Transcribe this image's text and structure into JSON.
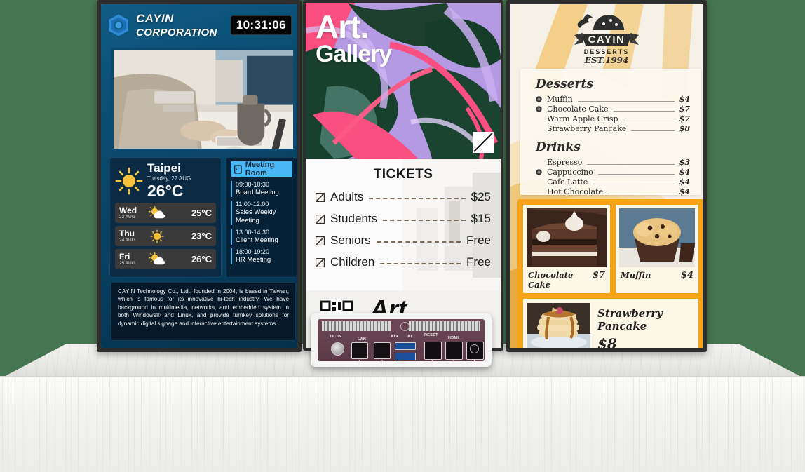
{
  "background_color": "#467552",
  "pedestal": {
    "name": "marble-display-pedestal"
  },
  "left_screen": {
    "name": "corporate-signage-screen",
    "header": {
      "logo_name": "cayin-hexagon-logo",
      "title_line1": "CAYIN",
      "title_line2": "CORPORATION",
      "clock": "10:31:06"
    },
    "photo_caption": "office-worker-photo",
    "weather": {
      "icon": "sun-icon",
      "city": "Taipei",
      "date": "Tuesday, 22 AUG",
      "temperature": "26°C",
      "forecast": [
        {
          "day": "Wed",
          "date": "23 AUG",
          "icon": "sun-cloud-icon",
          "temp": "25°C"
        },
        {
          "day": "Thu",
          "date": "24 AUG",
          "icon": "sun-icon",
          "temp": "23°C"
        },
        {
          "day": "Fri",
          "date": "25 AUG",
          "icon": "sun-cloud-icon",
          "temp": "26°C"
        }
      ]
    },
    "meeting_room": {
      "icon": "door-icon",
      "title": "Meeting Room",
      "entries": [
        {
          "time": "09:00-10:30",
          "name": "Board Meeting"
        },
        {
          "time": "11:00-12:00",
          "name": "Sales Weekly Meeting"
        },
        {
          "time": "13:00-14:30",
          "name": "Client Meeting"
        },
        {
          "time": "18:00-19:20",
          "name": "HR Meeting"
        }
      ]
    },
    "description": "CAYIN Technology Co., Ltd., founded in 2004, is based in Taiwan, which is famous for its innovative hi-tech industry. We have background in multimedia, networks, and embedded system in both Windows® and Linux, and provide turnkey solutions for dynamic digital signage and interactive entertainment systems."
  },
  "middle_screen": {
    "name": "art-gallery-signage-screen",
    "gallery": {
      "title_line1": "Art.",
      "title_line2": "Gallery",
      "logo_name": "gallery-mark-icon"
    },
    "tickets": {
      "title": "TICKETS",
      "rows": [
        {
          "icon": "ticket-icon",
          "label": "Adults",
          "price": "$25"
        },
        {
          "icon": "ticket-icon",
          "label": "Students",
          "price": "$15"
        },
        {
          "icon": "ticket-icon",
          "label": "Seniors",
          "price": "Free"
        },
        {
          "icon": "ticket-icon",
          "label": "Children",
          "price": "Free"
        }
      ]
    },
    "footer": {
      "qr_name": "qr-code-icon",
      "word": "Art"
    }
  },
  "device": {
    "name": "digital-signage-media-player",
    "ports": {
      "dc_in": "DC IN",
      "lan": "LAN",
      "lan1": "1",
      "lan2": "2",
      "atx": "ATX",
      "at": "AT",
      "reset": "RESET",
      "usb": "SS",
      "hdmi": "HDMI",
      "hdmi3": "3",
      "hdmi2": "2",
      "hdmi1": "1"
    }
  },
  "right_screen": {
    "name": "dessert-menu-signage-screen",
    "logo": {
      "brand": "CAYIN",
      "sub": "DESSERTS",
      "est": "EST.1994",
      "icon": "cupcake-badge-icon"
    },
    "menu": {
      "sections": [
        {
          "heading": "Desserts",
          "items": [
            {
              "name": "Muffin",
              "price": "$4",
              "marked": true
            },
            {
              "name": "Chocolate Cake",
              "price": "$7",
              "marked": true
            },
            {
              "name": "Warm Apple Crisp",
              "price": "$7",
              "marked": false
            },
            {
              "name": "Strawberry Pancake",
              "price": "$8",
              "marked": false
            }
          ]
        },
        {
          "heading": "Drinks",
          "items": [
            {
              "name": "Espresso",
              "price": "$3",
              "marked": false
            },
            {
              "name": "Cappuccino",
              "price": "$4",
              "marked": true
            },
            {
              "name": "Cafe Latte",
              "price": "$4",
              "marked": false
            },
            {
              "name": "Hot Chocolate",
              "price": "$4",
              "marked": false
            }
          ]
        }
      ]
    },
    "cards": [
      {
        "name": "Chocolate Cake",
        "price": "$7",
        "photo": "chocolate-cake-photo"
      },
      {
        "name": "Muffin",
        "price": "$4",
        "photo": "muffin-photo"
      }
    ],
    "feature_card": {
      "name": "Strawberry Pancake",
      "price": "$8",
      "photo": "strawberry-pancake-photo"
    },
    "accent_color": "#f5a417"
  }
}
